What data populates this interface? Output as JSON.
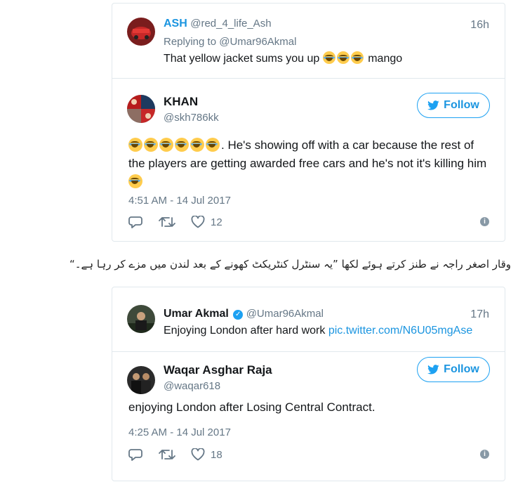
{
  "tweet1": {
    "quoted": {
      "name": "ASH",
      "handle": "@red_4_life_Ash",
      "time": "16h",
      "replying_to": "Replying to @Umar96Akmal",
      "text_before": "That yellow jacket sums you up ",
      "text_after": " mango",
      "emoji_count": 3
    },
    "author": {
      "name": "KHAN",
      "handle": "@skh786kk"
    },
    "follow_label": "Follow",
    "text_after_emojis": ". He's showing off with a car because the rest of the players are getting awarded free cars and he's not it's killing him ",
    "emoji_count": 6,
    "date": "4:51 AM - 14 Jul 2017",
    "likes": "12"
  },
  "urdu_caption": "وقار اصغر راجہ نے طنز کرتے ہوئے لکھا ”یہ سنٹرل کنٹریکٹ کھونے کے بعد لندن میں مزے کر رہا ہے۔“",
  "tweet2": {
    "quoted": {
      "name": "Umar Akmal",
      "handle": "@Umar96Akmal",
      "time": "17h",
      "text": "Enjoying London after hard work ",
      "link": "pic.twitter.com/N6U05mgAse"
    },
    "author": {
      "name": "Waqar Asghar Raja",
      "handle": "@waqar618"
    },
    "follow_label": "Follow",
    "text": "enjoying London after Losing Central Contract.",
    "date": "4:25 AM - 14 Jul 2017",
    "likes": "18"
  },
  "icons": {
    "reply": "reply-icon",
    "retweet": "retweet-icon",
    "like": "heart-icon",
    "info": "info-icon",
    "bird": "twitter-bird-icon",
    "emoji": "face-with-tears-of-joy-icon"
  },
  "colors": {
    "brand": "#1da1f2",
    "link": "#1b95e0",
    "muted": "#657786",
    "border": "#e1e8ed"
  }
}
